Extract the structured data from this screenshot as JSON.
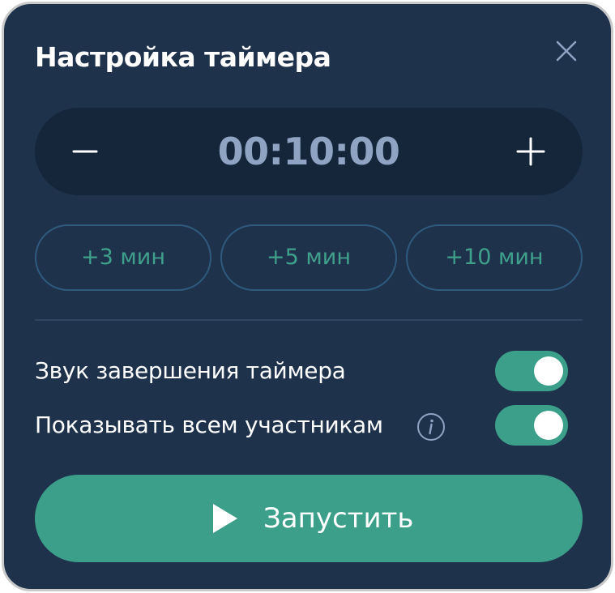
{
  "dialog": {
    "title": "Настройка таймера",
    "close_icon": "close-icon"
  },
  "timer": {
    "value": "00:10:00",
    "decrement_icon": "minus-icon",
    "increment_icon": "plus-icon"
  },
  "presets": [
    {
      "label": "+3 мин"
    },
    {
      "label": "+5 мин"
    },
    {
      "label": "+10 мин"
    }
  ],
  "settings": [
    {
      "label": "Звук завершения таймера",
      "enabled": true
    },
    {
      "label": "Показывать всем участникам",
      "enabled": true,
      "info_icon": "info-icon"
    }
  ],
  "start_button": {
    "label": "Запустить",
    "icon": "play-icon"
  },
  "colors": {
    "background": "#1f324c",
    "stepper_background": "#15263b",
    "accent": "#3c9f89",
    "preset_text": "#3fa08c",
    "preset_border": "#2f5a7f",
    "time_text": "#8ea4c2"
  }
}
